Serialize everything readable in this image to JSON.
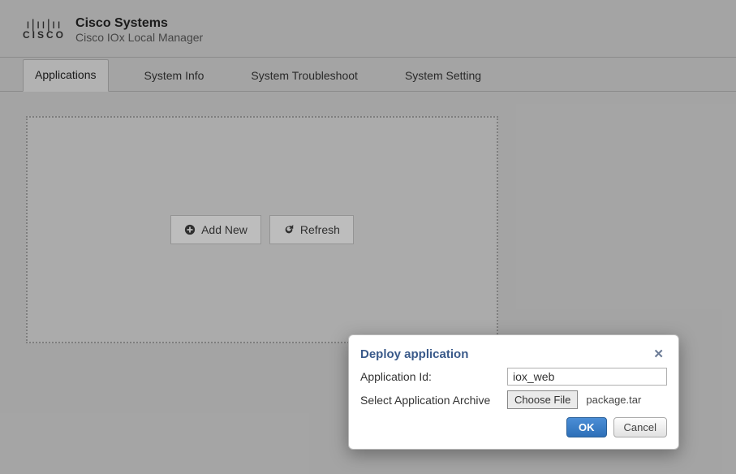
{
  "header": {
    "company": "Cisco Systems",
    "product": "Cisco IOx Local Manager"
  },
  "tabs": [
    {
      "label": "Applications",
      "active": true
    },
    {
      "label": "System Info",
      "active": false
    },
    {
      "label": "System Troubleshoot",
      "active": false
    },
    {
      "label": "System Setting",
      "active": false
    }
  ],
  "actions": {
    "add_new": "Add New",
    "refresh": "Refresh"
  },
  "dialog": {
    "title": "Deploy application",
    "app_id_label": "Application Id:",
    "app_id_value": "iox_web",
    "archive_label": "Select Application Archive",
    "choose_file_label": "Choose File",
    "file_name": "package.tar",
    "ok_label": "OK",
    "cancel_label": "Cancel"
  }
}
